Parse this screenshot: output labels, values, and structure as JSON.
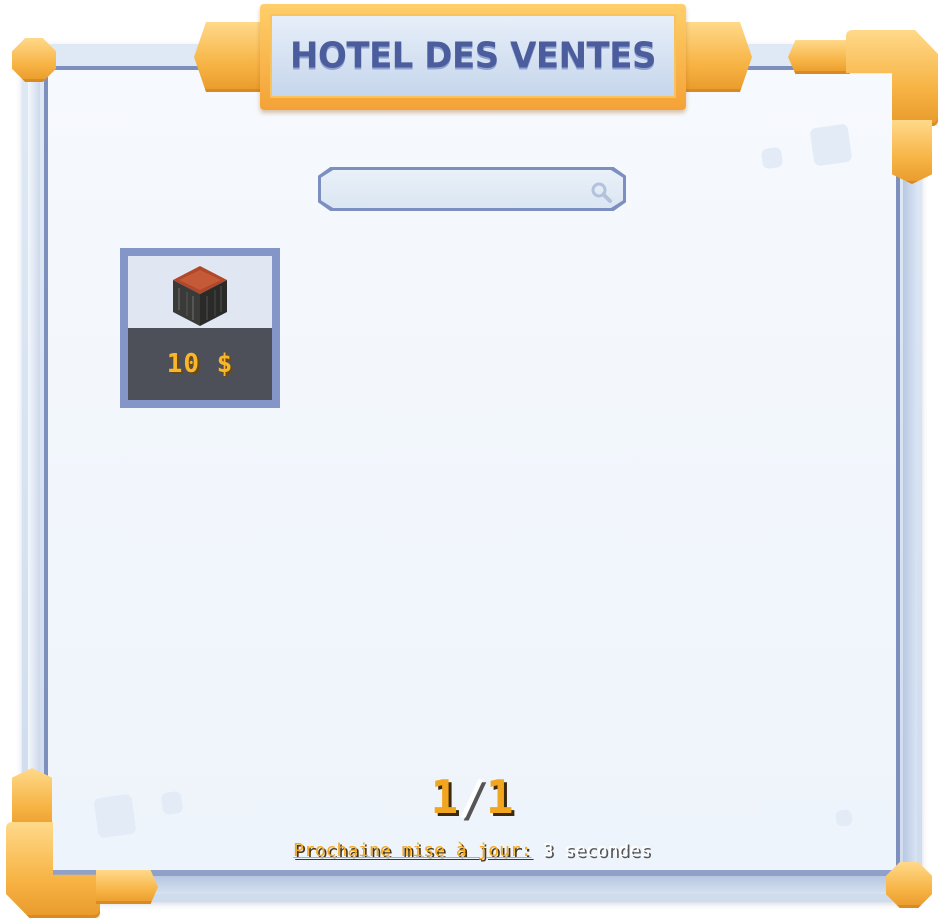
{
  "window": {
    "title": "HOTEL DES VENTES"
  },
  "search": {
    "value": "",
    "placeholder": ""
  },
  "items": [
    {
      "name": "wood-block",
      "price": "10 $"
    }
  ],
  "pagination": {
    "current": "1",
    "separator": "/",
    "total": "1"
  },
  "update": {
    "label": "Prochaine mise à jour:",
    "value": "3 secondes"
  },
  "colors": {
    "accent_orange": "#f4a236",
    "frame_blue": "#7d8fbd",
    "title_text": "#4b5d9c",
    "price_text": "#f7b62c"
  },
  "icons": [
    "search-icon",
    "wood-block-icon"
  ]
}
